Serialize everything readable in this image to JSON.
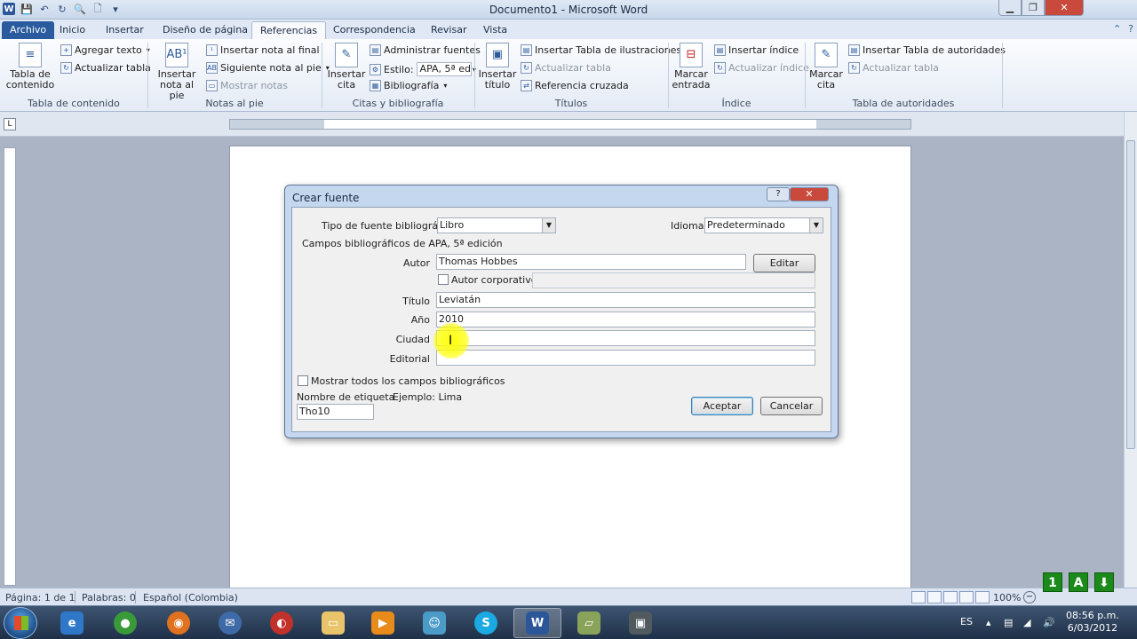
{
  "window": {
    "title": "Documento1  -  Microsoft Word",
    "min": "▁",
    "max": "❐",
    "close": "✕"
  },
  "tabs": [
    "Archivo",
    "Inicio",
    "Insertar",
    "Diseño de página",
    "Referencias",
    "Correspondencia",
    "Revisar",
    "Vista"
  ],
  "ribbon": {
    "toc": {
      "big": "Tabla de\ncontenido",
      "agregar": "Agregar texto",
      "actualizar": "Actualizar tabla",
      "group": "Tabla de contenido"
    },
    "notes": {
      "big": "Insertar\nnota al pie",
      "insertar_final": "Insertar nota al final",
      "siguiente": "Siguiente nota al pie",
      "mostrar": "Mostrar notas",
      "group": "Notas al pie"
    },
    "citas": {
      "big": "Insertar\ncita",
      "administrar": "Administrar fuentes",
      "estilo_label": "Estilo:",
      "estilo_value": "APA, 5ª ed",
      "bibliografia": "Bibliografía",
      "group": "Citas y bibliografía"
    },
    "titulos": {
      "big": "Insertar\ntítulo",
      "tabla_ilustraciones": "Insertar Tabla de ilustraciones",
      "actualizar": "Actualizar tabla",
      "referencia": "Referencia cruzada",
      "group": "Títulos"
    },
    "indice": {
      "big": "Marcar\nentrada",
      "insertar": "Insertar índice",
      "actualizar": "Actualizar índice",
      "group": "Índice"
    },
    "autoridades": {
      "big": "Marcar\ncita",
      "insertar": "Insertar Tabla de autoridades",
      "actualizar": "Actualizar tabla",
      "group": "Tabla de autoridades"
    }
  },
  "dialog": {
    "title": "Crear fuente",
    "help": "?",
    "close": "✕",
    "tipo_label": "Tipo de fuente bibliográfica",
    "tipo_value": "Libro",
    "idioma_label": "Idioma",
    "idioma_value": "Predeterminado",
    "campos_label": "Campos bibliográficos de APA, 5ª edición",
    "autor_label": "Autor",
    "autor_value": "Thomas Hobbes",
    "editar": "Editar",
    "autor_corporativo": "Autor corporativo",
    "titulo_label": "Título",
    "titulo_value": "Leviatán",
    "anio_label": "Año",
    "anio_value": "2010",
    "ciudad_label": "Ciudad",
    "ciudad_value": "",
    "editorial_label": "Editorial",
    "editorial_value": "",
    "mostrar_todos": "Mostrar todos los campos bibliográficos",
    "nombre_etiqueta_label": "Nombre de etiqueta",
    "ejemplo": "Ejemplo: Lima",
    "nombre_etiqueta_value": "Tho10",
    "aceptar": "Aceptar",
    "cancelar": "Cancelar"
  },
  "status": {
    "pagina": "Página: 1 de 1",
    "palabras": "Palabras: 0",
    "idioma": "Español (Colombia)",
    "zoom": "100%"
  },
  "overlay": {
    "btn1": "1",
    "btnA": "A",
    "btnDown": "⬇"
  },
  "taskbar": {
    "lang": "ES",
    "time": "08:56 p.m.",
    "date": "6/03/2012"
  }
}
